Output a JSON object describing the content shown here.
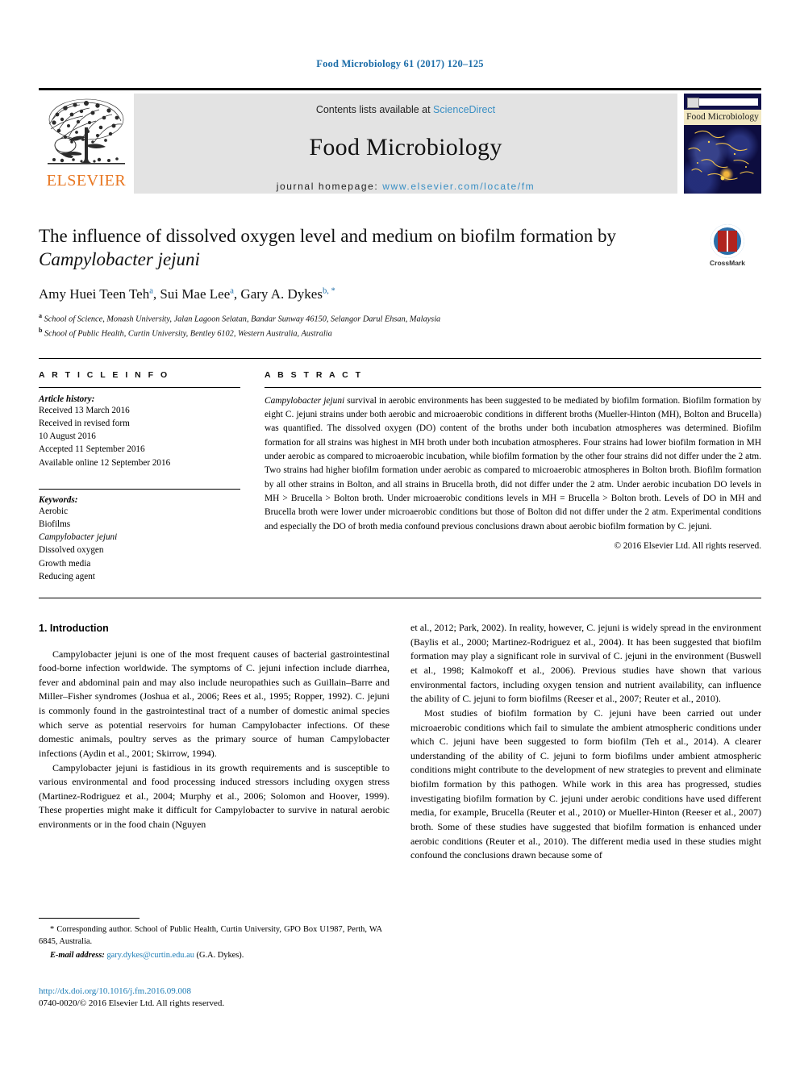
{
  "running_head": "Food Microbiology 61 (2017) 120–125",
  "masthead": {
    "publisher_name": "ELSEVIER",
    "contents_prefix": "Contents lists available at ",
    "sciencedirect": "ScienceDirect",
    "journal_name": "Food Microbiology",
    "homepage_prefix": "journal homepage: ",
    "homepage_url": "www.elsevier.com/locate/fm",
    "cover_title": "Food Microbiology"
  },
  "article": {
    "title_part1": "The influence of dissolved oxygen level and medium on biofilm formation by ",
    "title_italic": "Campylobacter jejuni",
    "authors": "Amy Huei Teen Teh a, Sui Mae Lee a, Gary A. Dykes b, *",
    "author_1": "Amy Huei Teen Teh",
    "author_1_sup": "a",
    "author_2": "Sui Mae Lee",
    "author_2_sup": "a",
    "author_3": "Gary A. Dykes",
    "author_3_sup": "b, *",
    "affiliation_a_sup": "a",
    "affiliation_a": "School of Science, Monash University, Jalan Lagoon Selatan, Bandar Sunway 46150, Selangor Darul Ehsan, Malaysia",
    "affiliation_b_sup": "b",
    "affiliation_b": "School of Public Health, Curtin University, Bentley 6102, Western Australia, Australia",
    "crossmark_label": "CrossMark"
  },
  "article_info": {
    "heading": "A R T I C L E  I N F O",
    "history_label": "Article history:",
    "history": [
      "Received 13 March 2016",
      "Received in revised form",
      "10 August 2016",
      "Accepted 11 September 2016",
      "Available online 12 September 2016"
    ],
    "keywords_label": "Keywords:",
    "keywords": [
      "Aerobic",
      "Biofilms",
      "Campylobacter jejuni",
      "Dissolved oxygen",
      "Growth media",
      "Reducing agent"
    ],
    "keyword_italic_index": 2
  },
  "abstract": {
    "heading": "A B S T R A C T",
    "lead_italic": "Campylobacter jejuni",
    "text": " survival in aerobic environments has been suggested to be mediated by biofilm formation. Biofilm formation by eight C. jejuni strains under both aerobic and microaerobic conditions in different broths (Mueller-Hinton (MH), Bolton and Brucella) was quantified. The dissolved oxygen (DO) content of the broths under both incubation atmospheres was determined. Biofilm formation for all strains was highest in MH broth under both incubation atmospheres. Four strains had lower biofilm formation in MH under aerobic as compared to microaerobic incubation, while biofilm formation by the other four strains did not differ under the 2 atm. Two strains had higher biofilm formation under aerobic as compared to microaerobic atmospheres in Bolton broth. Biofilm formation by all other strains in Bolton, and all strains in Brucella broth, did not differ under the 2 atm. Under aerobic incubation DO levels in MH > Brucella > Bolton broth. Under microaerobic conditions levels in MH = Brucella > Bolton broth. Levels of DO in MH and Brucella broth were lower under microaerobic conditions but those of Bolton did not differ under the 2 atm. Experimental conditions and especially the DO of broth media confound previous conclusions drawn about aerobic biofilm formation by C. jejuni.",
    "copyright": "© 2016 Elsevier Ltd. All rights reserved."
  },
  "body": {
    "section_heading": "1. Introduction",
    "left_paragraph_1": "Campylobacter jejuni is one of the most frequent causes of bacterial gastrointestinal food-borne infection worldwide. The symptoms of C. jejuni infection include diarrhea, fever and abdominal pain and may also include neuropathies such as Guillain–Barre and Miller–Fisher syndromes (Joshua et al., 2006; Rees et al., 1995; Ropper, 1992). C. jejuni is commonly found in the gastrointestinal tract of a number of domestic animal species which serve as potential reservoirs for human Campylobacter infections. Of these domestic animals, poultry serves as the primary source of human Campylobacter infections (Aydin et al., 2001; Skirrow, 1994).",
    "left_paragraph_2": "Campylobacter jejuni is fastidious in its growth requirements and is susceptible to various environmental and food processing induced stressors including oxygen stress (Martinez-Rodriguez et al., 2004; Murphy et al., 2006; Solomon and Hoover, 1999). These properties might make it difficult for Campylobacter to survive in natural aerobic environments or in the food chain (Nguyen",
    "right_paragraph_1": "et al., 2012; Park, 2002). In reality, however, C. jejuni is widely spread in the environment (Baylis et al., 2000; Martinez-Rodriguez et al., 2004). It has been suggested that biofilm formation may play a significant role in survival of C. jejuni in the environment (Buswell et al., 1998; Kalmokoff et al., 2006). Previous studies have shown that various environmental factors, including oxygen tension and nutrient availability, can influence the ability of C. jejuni to form biofilms (Reeser et al., 2007; Reuter et al., 2010).",
    "right_paragraph_2": "Most studies of biofilm formation by C. jejuni have been carried out under microaerobic conditions which fail to simulate the ambient atmospheric conditions under which C. jejuni have been suggested to form biofilm (Teh et al., 2014). A clearer understanding of the ability of C. jejuni to form biofilms under ambient atmospheric conditions might contribute to the development of new strategies to prevent and eliminate biofilm formation by this pathogen. While work in this area has progressed, studies investigating biofilm formation by C. jejuni under aerobic conditions have used different media, for example, Brucella (Reuter et al., 2010) or Mueller-Hinton (Reeser et al., 2007) broth. Some of these studies have suggested that biofilm formation is enhanced under aerobic conditions (Reuter et al., 2010). The different media used in these studies might confound the conclusions drawn because some of"
  },
  "footnote": {
    "corresponding_marker": "*",
    "corresponding_text": "Corresponding author. School of Public Health, Curtin University, GPO Box U1987, Perth, WA 6845, Australia.",
    "email_label": "E-mail address:",
    "email": "gary.dykes@curtin.edu.au",
    "email_owner": "(G.A. Dykes)."
  },
  "doi_block": {
    "doi_url": "http://dx.doi.org/10.1016/j.fm.2016.09.008",
    "issn_line": "0740-0020/© 2016 Elsevier Ltd. All rights reserved."
  },
  "colors": {
    "link_blue": "#1b7bb5",
    "header_blue": "#1b6ca8",
    "elsevier_orange": "#E87722",
    "band_gray": "#e3e3e3"
  }
}
